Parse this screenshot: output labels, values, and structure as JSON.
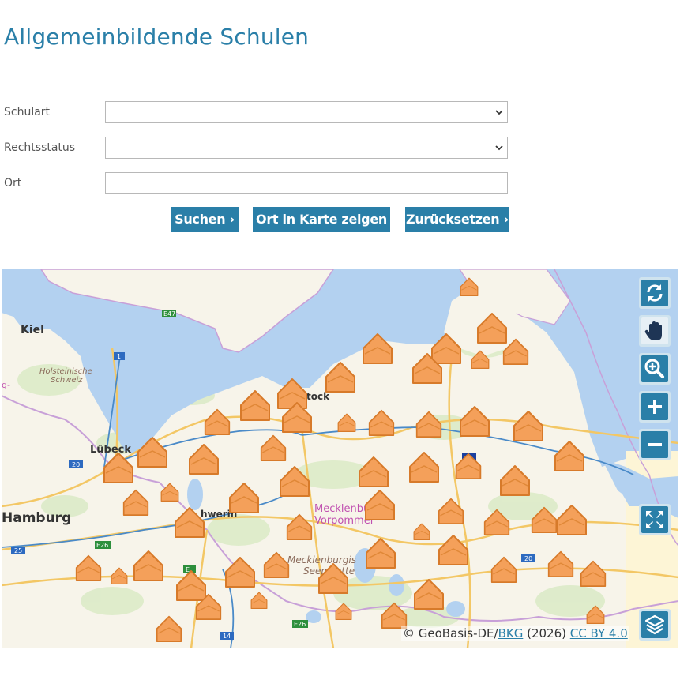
{
  "page_title": "Allgemeinbildende Schulen",
  "form": {
    "schulart_label": "Schulart",
    "schulart_value": "",
    "rechtsstatus_label": "Rechtsstatus",
    "rechtsstatus_value": "",
    "ort_label": "Ort",
    "ort_value": ""
  },
  "buttons": {
    "search": "Suchen ›",
    "show_place": "Ort in Karte zeigen ›",
    "reset": "Zurücksetzen ›"
  },
  "map": {
    "place_labels": {
      "kiel": "Kiel",
      "holsteinische_1": "Holsteinische",
      "holsteinische_2": "Schweiz",
      "luebeck": "Lübeck",
      "hamburg": "Hamburg",
      "schwerin": "hwerin",
      "rostock": "tock",
      "mv_1": "Mecklenbu",
      "mv_2": "Vorpommer",
      "seenplatte_1": "Mecklenburgis",
      "seenplatte_2": "Seenplatte",
      "edge": "g-"
    },
    "road_shields": {
      "e47": "E47",
      "a1": "1",
      "a20": "20",
      "a25": "25",
      "e26a": "E26",
      "e26b": "E26",
      "a14": "14",
      "e22": "E",
      "a20b": "20"
    },
    "controls": [
      "refresh-icon",
      "pan-hand-icon",
      "zoom-in-magnifier-icon",
      "plus-icon",
      "minus-icon",
      "fullscreen-icon",
      "layers-icon"
    ],
    "attribution_prefix": "© GeoBasis-DE/",
    "attribution_bkg": "BKG",
    "attribution_year": " (2026) ",
    "attribution_license": "CC BY 4.0",
    "colors": {
      "marker_fill": "#f4a05a",
      "marker_stroke": "#d77a2a",
      "water": "#b3d1f0",
      "accent": "#2a7fa8"
    }
  }
}
